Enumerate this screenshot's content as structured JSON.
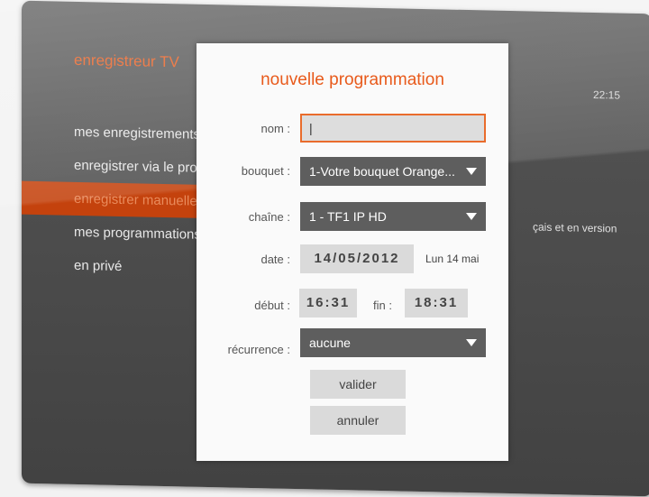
{
  "background": {
    "app_title": "enregistreur TV",
    "clock": "22:15",
    "menu": [
      {
        "label": "mes enregistrements",
        "active": false
      },
      {
        "label": "enregistrer via le programme",
        "active": false
      },
      {
        "label": "enregistrer manuellement",
        "active": true
      },
      {
        "label": "mes programmations",
        "active": false
      },
      {
        "label": "en privé",
        "active": false
      }
    ],
    "side_text": "çais et en version"
  },
  "dialog": {
    "title": "nouvelle programmation",
    "name": {
      "label": "nom :",
      "value": "|"
    },
    "bouquet": {
      "label": "bouquet :",
      "value": "1-Votre bouquet Orange..."
    },
    "chaine": {
      "label": "chaîne :",
      "value": "1 - TF1 IP HD"
    },
    "date": {
      "label": "date :",
      "value": "14/05/2012",
      "weekday": "Lun 14 mai"
    },
    "debut": {
      "label": "début :",
      "value": "16:31"
    },
    "fin": {
      "label": "fin :",
      "value": "18:31"
    },
    "recurrence": {
      "label": "récurrence :",
      "value": "aucune"
    },
    "validate_label": "valider",
    "cancel_label": "annuler"
  },
  "colors": {
    "accent": "#e85a1b",
    "menu_highlight": "#c4420d",
    "select_bg": "#5e5e5e",
    "field_bg": "#dadada"
  },
  "icons": {
    "dropdown": "triangle-down-icon"
  }
}
